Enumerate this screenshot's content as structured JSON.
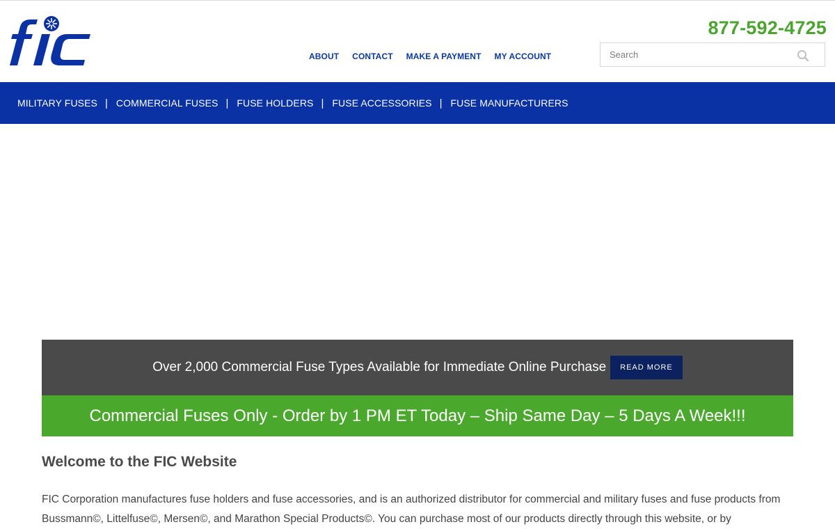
{
  "brand": {
    "logo_text": "fic",
    "primary_color": "#0a32a5",
    "accent_color": "#4aa52e"
  },
  "header": {
    "phone": "877-592-4725",
    "top_links": [
      "ABOUT",
      "CONTACT",
      "MAKE A PAYMENT",
      "MY ACCOUNT"
    ],
    "search": {
      "placeholder": "Search",
      "value": "",
      "icon": "search-icon"
    }
  },
  "main_nav": {
    "items": [
      "MILITARY FUSES",
      "COMMERCIAL FUSES",
      "FUSE HOLDERS",
      "FUSE ACCESSORIES",
      "FUSE MANUFACTURERS"
    ],
    "separator": "|"
  },
  "banners": {
    "promo_text": "Over 2,000 Commercial Fuse Types Available for Immediate Online Purchase",
    "read_more_label": "READ MORE",
    "shipping_text": "Commercial Fuses Only - Order by 1 PM ET Today – Ship Same Day – 5 Days A Week!!!"
  },
  "content": {
    "welcome_title": "Welcome to the FIC Website",
    "intro_text": "FIC Corporation manufactures fuse holders and fuse accessories, and is an authorized distributor for commercial and military fuses and fuse products from Bussmann©, Littelfuse©, Mersen©, and Marathon Special Products©. You can purchase most of our products directly through this website, or by"
  }
}
